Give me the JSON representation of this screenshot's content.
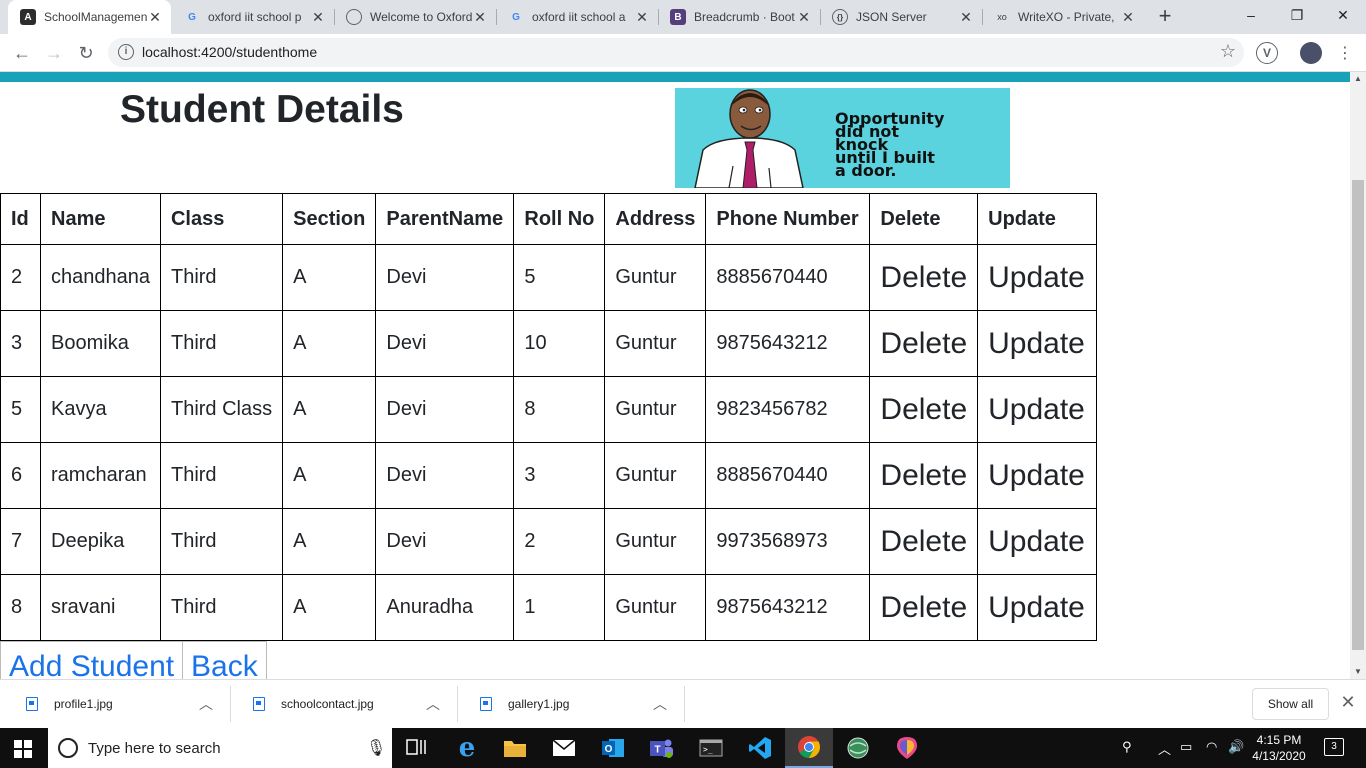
{
  "browser": {
    "tabs": [
      {
        "title": "SchoolManagement",
        "favicon": "angular-icon",
        "active": true
      },
      {
        "title": "oxford iit school p",
        "favicon": "google-icon",
        "active": false
      },
      {
        "title": "Welcome to Oxford",
        "favicon": "globe-icon",
        "active": false
      },
      {
        "title": "oxford iit school a",
        "favicon": "google-icon",
        "active": false
      },
      {
        "title": "Breadcrumb · Boot",
        "favicon": "bootstrap-icon",
        "active": false
      },
      {
        "title": "JSON Server",
        "favicon": "json-server-icon",
        "active": false
      },
      {
        "title": "WriteXO - Private,",
        "favicon_text": "xo",
        "active": false
      }
    ],
    "new_tab": "+",
    "window_controls": {
      "minimize": "–",
      "maximize": "❐",
      "close": "✕"
    },
    "url": "localhost:4200/studenthome",
    "nav": {
      "back": "←",
      "forward": "→",
      "reload": "↻"
    },
    "extension_label": "V"
  },
  "page": {
    "heading": "Student Details",
    "banner_text": "Opportunity\ndid not\nknock\nuntil I built\na door.",
    "accent_color": "#17a2b8",
    "table": {
      "headers": [
        "Id",
        "Name",
        "Class",
        "Section",
        "ParentName",
        "Roll No",
        "Address",
        "Phone Number",
        "Delete",
        "Update"
      ],
      "rows": [
        {
          "id": "2",
          "name": "chandhana",
          "class": "Third",
          "section": "A",
          "parent": "Devi",
          "roll": "5",
          "address": "Guntur",
          "phone": "8885670440",
          "delete": "Delete",
          "update": "Update"
        },
        {
          "id": "3",
          "name": "Boomika",
          "class": "Third",
          "section": "A",
          "parent": "Devi",
          "roll": "10",
          "address": "Guntur",
          "phone": "9875643212",
          "delete": "Delete",
          "update": "Update"
        },
        {
          "id": "5",
          "name": "Kavya",
          "class": "Third Class",
          "section": "A",
          "parent": "Devi",
          "roll": "8",
          "address": "Guntur",
          "phone": "9823456782",
          "delete": "Delete",
          "update": "Update"
        },
        {
          "id": "6",
          "name": "ramcharan",
          "class": "Third",
          "section": "A",
          "parent": "Devi",
          "roll": "3",
          "address": "Guntur",
          "phone": "8885670440",
          "delete": "Delete",
          "update": "Update"
        },
        {
          "id": "7",
          "name": "Deepika",
          "class": "Third",
          "section": "A",
          "parent": "Devi",
          "roll": "2",
          "address": "Guntur",
          "phone": "9973568973",
          "delete": "Delete",
          "update": "Update"
        },
        {
          "id": "8",
          "name": "sravani",
          "class": "Third",
          "section": "A",
          "parent": "Anuradha",
          "roll": "1",
          "address": "Guntur",
          "phone": "9875643212",
          "delete": "Delete",
          "update": "Update"
        }
      ]
    },
    "add_student": "Add Student",
    "back": "Back"
  },
  "downloads": {
    "items": [
      "profile1.jpg",
      "schoolcontact.jpg",
      "gallery1.jpg"
    ],
    "show_all": "Show all"
  },
  "taskbar": {
    "search_placeholder": "Type here to search",
    "time": "4:15 PM",
    "date": "4/13/2020",
    "notifications": "3"
  }
}
